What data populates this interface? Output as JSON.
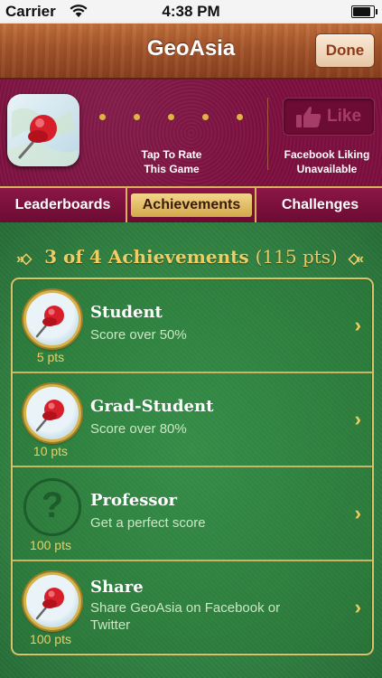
{
  "status_bar": {
    "carrier": "Carrier",
    "time": "4:38 PM",
    "battery_level": 0.95
  },
  "navbar": {
    "title": "GeoAsia",
    "done_label": "Done"
  },
  "game_header": {
    "rate_line1": "Tap To Rate",
    "rate_line2": "This Game",
    "like_label": "Like",
    "fb_line1": "Facebook Liking",
    "fb_line2": "Unavailable"
  },
  "tabs": [
    {
      "label": "Leaderboards"
    },
    {
      "label": "Achievements"
    },
    {
      "label": "Challenges"
    }
  ],
  "achievements": {
    "heading_count": "3 of 4 Achievements",
    "heading_pts": "(115 pts)",
    "items": [
      {
        "title": "Student",
        "desc": "Score over 50%",
        "pts": "5 pts"
      },
      {
        "title": "Grad-Student",
        "desc": "Score over 80%",
        "pts": "10 pts"
      },
      {
        "title": "Professor",
        "desc": "Get a perfect score",
        "pts": "100 pts"
      },
      {
        "title": "Share",
        "desc": "Share GeoAsia on Facebook or Twitter",
        "pts": "100 pts"
      }
    ]
  },
  "colors": {
    "gold": "#f0cd62",
    "maroon": "#7d0f3f",
    "felt": "#2f7e40",
    "wood": "#a4552b"
  }
}
